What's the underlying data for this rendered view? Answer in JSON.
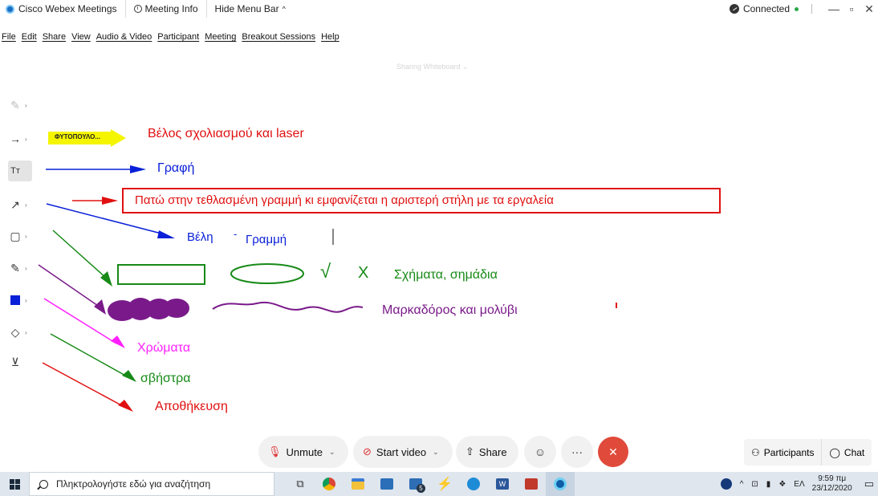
{
  "titlebar": {
    "app_name": "Cisco Webex Meetings",
    "meeting_info": "Meeting Info",
    "hide_menu": "Hide Menu Bar",
    "status": "Connected"
  },
  "menu": [
    "File",
    "Edit",
    "Share",
    "View",
    "Audio & Video",
    "Participant",
    "Meeting",
    "Breakout Sessions",
    "Help"
  ],
  "share_label": "Sharing Whiteboard",
  "toolbar": {
    "text_tool": "Tт",
    "pointer_color": "#f5f500",
    "selected_color": "#0a20d8"
  },
  "annotations": {
    "pointer_name": "ΦΥΤΟΠΟΥΛΟ...",
    "pointer_desc": "Βέλος σχολιασμού και laser",
    "writing": "Γραφή",
    "instruction": "Πατώ στην τεθλασμένη γραμμή κι εμφανίζεται η αριστερή στήλη με τα εργαλεία",
    "arrows_lines_a": "Βέλη",
    "arrows_lines_dash": "-",
    "arrows_lines_b": "Γραμμή",
    "shapes_check": "√",
    "shapes_x": "X",
    "shapes": "Σχήματα, σημάδια",
    "marker_pencil": "Μαρκαδόρος και μολύβι",
    "colors": "Χρώματα",
    "eraser": "σβήστρα",
    "save": "Αποθήκευση"
  },
  "controls": {
    "unmute": "Unmute",
    "start_video": "Start video",
    "share": "Share",
    "more": "···",
    "participants": "Participants",
    "chat": "Chat"
  },
  "taskbar": {
    "search_placeholder": "Πληκτρολογήστε εδώ για αναζήτηση",
    "lang": "ΕΛ",
    "time": "9:59 πμ",
    "date": "23/12/2020",
    "badge": "5"
  }
}
